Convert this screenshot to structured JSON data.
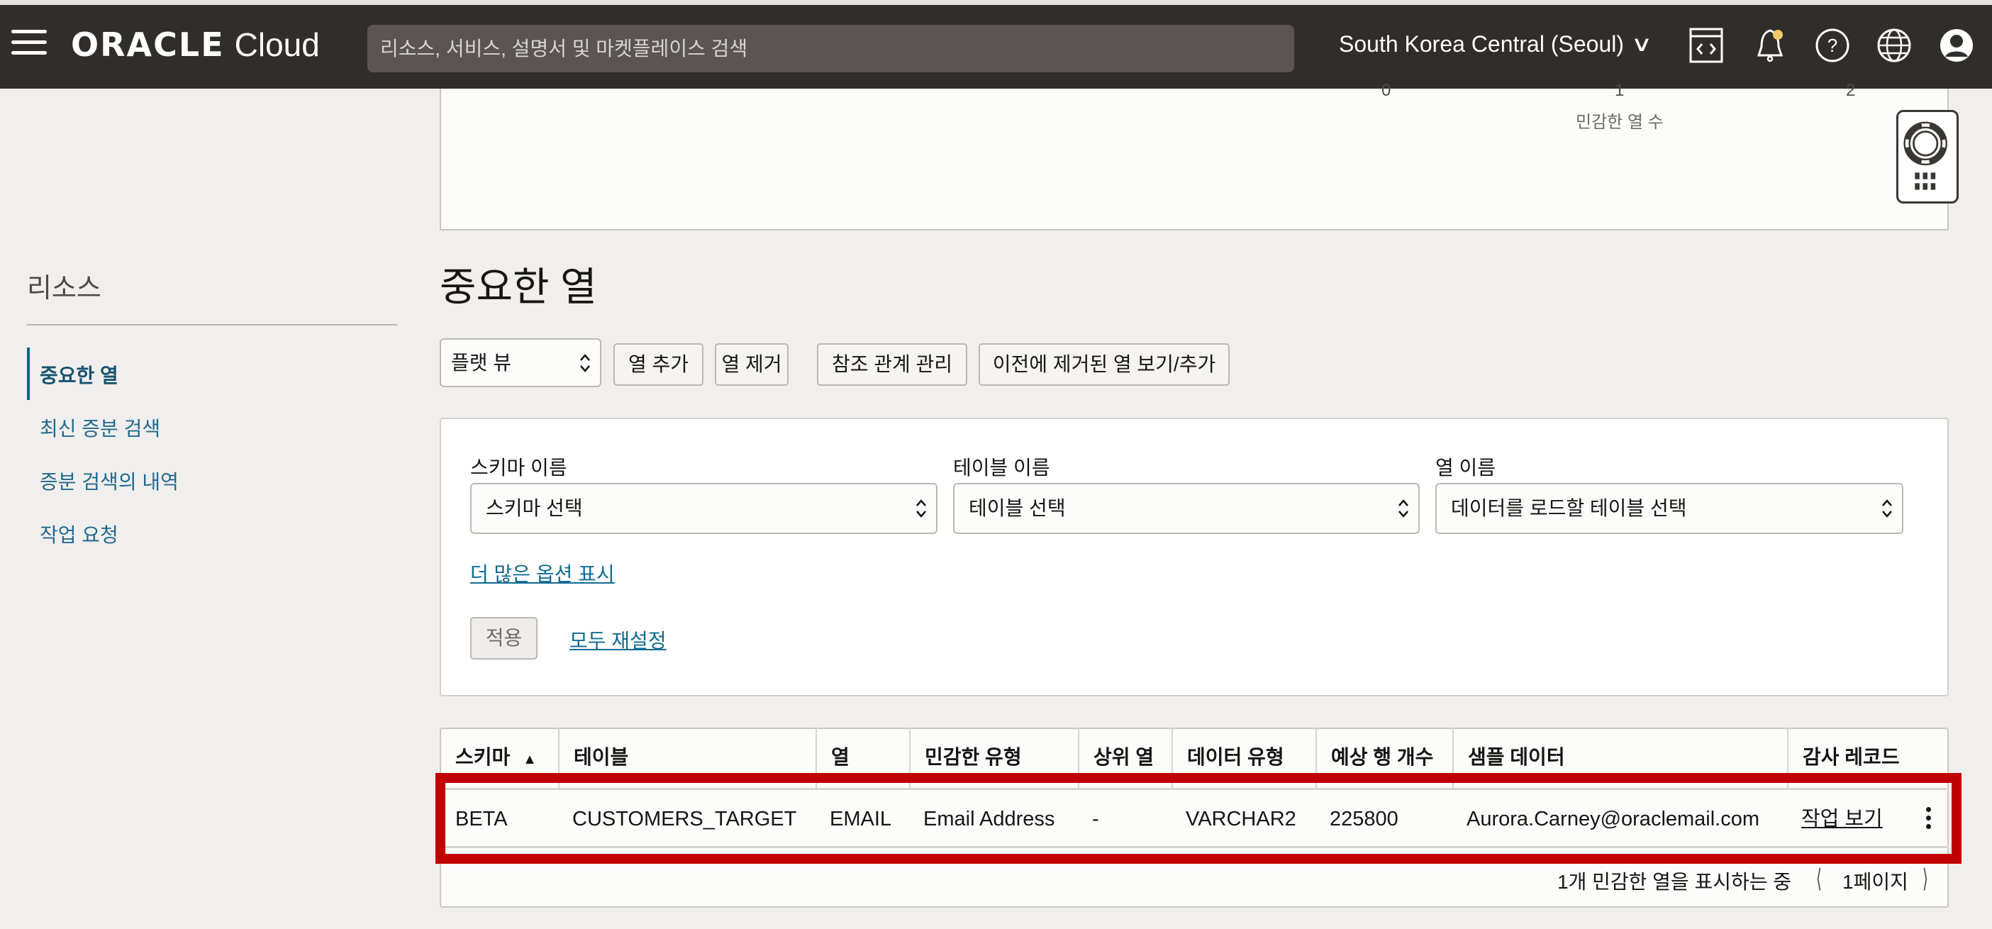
{
  "header": {
    "menu_icon": "hamburger-menu-icon",
    "logo_brand": "ORACLE",
    "logo_product": "Cloud",
    "search_placeholder": "리소스, 서비스, 설명서 및 마켓플레이스 검색",
    "region": "South Korea Central (Seoul)",
    "icons": [
      "code-editor-icon",
      "bell-icon",
      "help-icon",
      "globe-icon",
      "user-avatar-icon"
    ],
    "notification_dot_color": "#f2c86a"
  },
  "chart": {
    "ticks": [
      "0",
      "1",
      "2"
    ],
    "axis_title": "민감한 열 수"
  },
  "help_widget": {
    "icon": "lifebuoy-icon"
  },
  "sidebar": {
    "title": "리소스",
    "items": [
      {
        "label": "중요한 열",
        "active": true
      },
      {
        "label": "최신 증분 검색",
        "active": false
      },
      {
        "label": "증분 검색의 내역",
        "active": false
      },
      {
        "label": "작업 요청",
        "active": false
      }
    ]
  },
  "main": {
    "title": "중요한 열",
    "toolbar": {
      "view_select": "플랫 뷰",
      "buttons": [
        "열 추가",
        "열 제거",
        "참조 관계 관리",
        "이전에 제거된 열 보기/추가"
      ]
    },
    "filters": {
      "schema_label": "스키마 이름",
      "schema_value": "스키마 선택",
      "table_label": "테이블 이름",
      "table_value": "테이블 선택",
      "column_label": "열 이름",
      "column_value": "데이터를 로드할 테이블 선택",
      "more_options": "더 많은 옵션 표시",
      "apply": "적용",
      "reset_all": "모두 재설정"
    },
    "table": {
      "columns": [
        "스키마",
        "테이블",
        "열",
        "민감한 유형",
        "상위 열",
        "데이터 유형",
        "예상 행 개수",
        "샘플 데이터",
        "감사 레코드"
      ],
      "sort_indicator": "▲",
      "rows": [
        {
          "schema": "BETA",
          "table": "CUSTOMERS_TARGET",
          "column": "EMAIL",
          "sensitive_type": "Email Address",
          "parent_column": "-",
          "data_type": "VARCHAR2",
          "estimated_rows": "225800",
          "sample_data": "Aurora.Carney@oraclemail.com",
          "audit_records": "작업 보기"
        }
      ],
      "footer_status": "1개 민감한 열을 표시하는 중",
      "page_label": "1페이지"
    }
  },
  "colors": {
    "header_bg": "#312d2a",
    "link": "#0f6a93",
    "highlight": "#c00000"
  }
}
